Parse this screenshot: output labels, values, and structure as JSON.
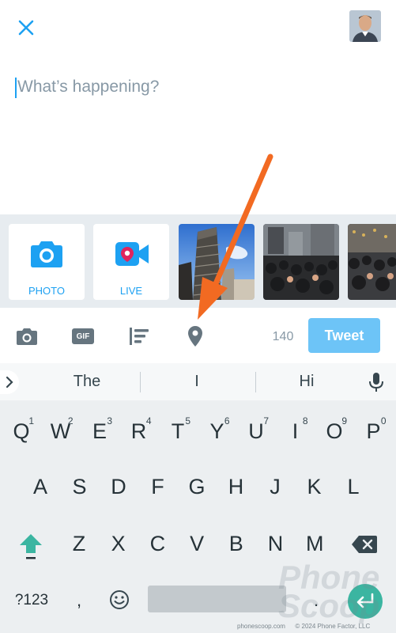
{
  "compose": {
    "placeholder": "What’s happening?"
  },
  "media_strip": {
    "photo_label": "PHOTO",
    "live_label": "LIVE"
  },
  "toolbar": {
    "gif_label": "GIF",
    "char_count": "140",
    "tweet_label": "Tweet"
  },
  "keyboard": {
    "suggestions": [
      "The",
      "I",
      "Hi"
    ],
    "row1": [
      {
        "k": "Q",
        "h": "1"
      },
      {
        "k": "W",
        "h": "2"
      },
      {
        "k": "E",
        "h": "3"
      },
      {
        "k": "R",
        "h": "4"
      },
      {
        "k": "T",
        "h": "5"
      },
      {
        "k": "Y",
        "h": "6"
      },
      {
        "k": "U",
        "h": "7"
      },
      {
        "k": "I",
        "h": "8"
      },
      {
        "k": "O",
        "h": "9"
      },
      {
        "k": "P",
        "h": "0"
      }
    ],
    "row2": [
      "A",
      "S",
      "D",
      "F",
      "G",
      "H",
      "J",
      "K",
      "L"
    ],
    "row3": [
      "Z",
      "X",
      "C",
      "V",
      "B",
      "N",
      "M"
    ],
    "symbols_label": "?123",
    "comma_label": ",",
    "period_label": "."
  },
  "watermark": {
    "line1": "Phone",
    "line2": "Scoop"
  },
  "footer": {
    "site": "phonescoop.com",
    "copyright": "© 2024 Phone Factor, LLC"
  },
  "colors": {
    "accent": "#1da1f2",
    "tweet_button": "#6dc4f7",
    "arrow": "#f26a22",
    "enter": "#3bb5a1",
    "shift": "#3bb5a1"
  }
}
